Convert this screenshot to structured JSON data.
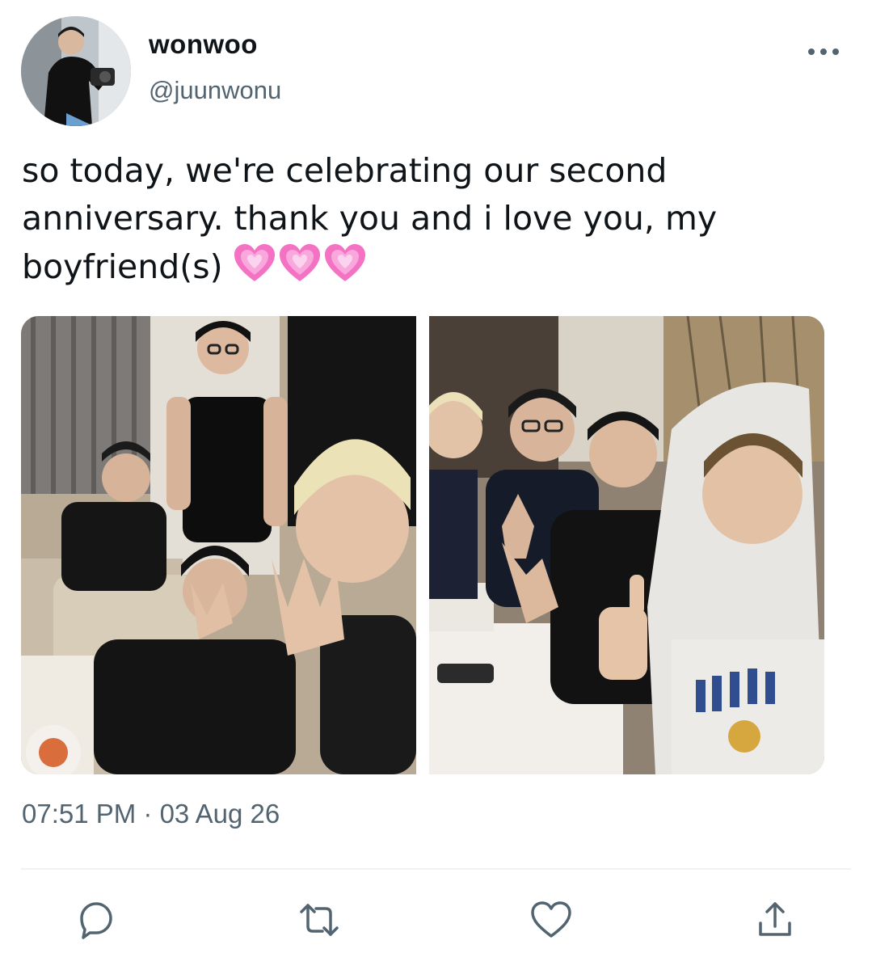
{
  "user": {
    "display_name": "wonwoo",
    "handle": "@juunwonu",
    "avatar_icon": "profile-photo"
  },
  "tweet": {
    "text_line1": "so today, we're celebrating our second",
    "text_line2": "anniversary. thank you and i love you, my",
    "text_line3": "boyfriend(s)",
    "emoji": [
      "growing-heart",
      "growing-heart",
      "growing-heart"
    ],
    "timestamp": "07:51 PM · 03 Aug 26"
  },
  "media": {
    "count": 2
  },
  "actions": [
    {
      "name": "reply",
      "icon": "speech-bubble-icon"
    },
    {
      "name": "retweet",
      "icon": "retweet-icon"
    },
    {
      "name": "like",
      "icon": "heart-icon"
    },
    {
      "name": "share",
      "icon": "share-icon"
    }
  ],
  "colors": {
    "text": "#0f1419",
    "secondary": "#536471",
    "divider": "#eff3f4",
    "heart_pink": "#f472c4"
  }
}
